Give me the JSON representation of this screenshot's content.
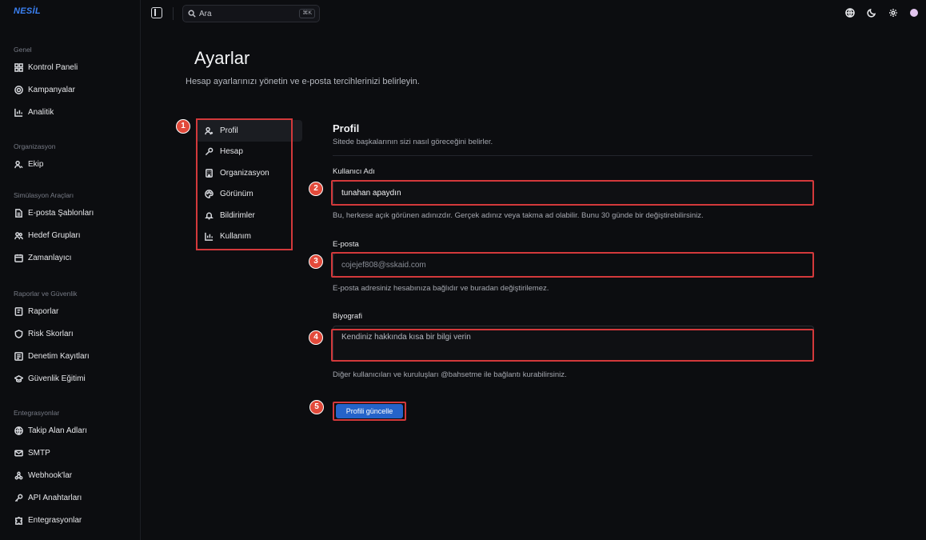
{
  "app": {
    "logo": "NESİL"
  },
  "topbar": {
    "search_placeholder": "Ara",
    "search_shortcut": "⌘K"
  },
  "sidebar": {
    "groups": [
      {
        "title": "Genel",
        "items": [
          {
            "label": "Kontrol Paneli",
            "icon": "grid-icon"
          },
          {
            "label": "Kampanyalar",
            "icon": "target-icon"
          },
          {
            "label": "Analitik",
            "icon": "bar-chart-icon"
          }
        ]
      },
      {
        "title": "Organizasyon",
        "items": [
          {
            "label": "Ekip",
            "icon": "users-icon"
          }
        ]
      },
      {
        "title": "Simülasyon Araçları",
        "items": [
          {
            "label": "E-posta Şablonları",
            "icon": "file-icon"
          },
          {
            "label": "Hedef Grupları",
            "icon": "group-icon"
          },
          {
            "label": "Zamanlayıcı",
            "icon": "calendar-icon"
          }
        ]
      },
      {
        "title": "Raporlar ve Güvenlik",
        "items": [
          {
            "label": "Raporlar",
            "icon": "report-icon"
          },
          {
            "label": "Risk Skorları",
            "icon": "shield-icon"
          },
          {
            "label": "Denetim Kayıtları",
            "icon": "audit-icon"
          },
          {
            "label": "Güvenlik Eğitimi",
            "icon": "graduation-icon"
          }
        ]
      },
      {
        "title": "Entegrasyonlar",
        "items": [
          {
            "label": "Takip Alan Adları",
            "icon": "globe-icon"
          },
          {
            "label": "SMTP",
            "icon": "mail-icon"
          },
          {
            "label": "Webhook'lar",
            "icon": "webhook-icon"
          },
          {
            "label": "API Anahtarları",
            "icon": "key-icon"
          },
          {
            "label": "Entegrasyonlar",
            "icon": "puzzle-icon"
          }
        ]
      }
    ]
  },
  "page": {
    "title": "Ayarlar",
    "subtitle": "Hesap ayarlarınızı yönetin ve e-posta tercihlerinizi belirleyin."
  },
  "settings_nav": [
    {
      "label": "Profil",
      "icon": "user-icon",
      "active": true
    },
    {
      "label": "Hesap",
      "icon": "wrench-icon"
    },
    {
      "label": "Organizasyon",
      "icon": "building-icon"
    },
    {
      "label": "Görünüm",
      "icon": "palette-icon"
    },
    {
      "label": "Bildirimler",
      "icon": "bell-icon"
    },
    {
      "label": "Kullanım",
      "icon": "bar-chart-icon"
    }
  ],
  "profile": {
    "title": "Profil",
    "subtitle": "Sitede başkalarının sizi nasıl göreceğini belirler.",
    "username_label": "Kullanıcı Adı",
    "username_value": "tunahan apaydın",
    "username_hint": "Bu, herkese açık görünen adınızdır. Gerçek adınız veya takma ad olabilir. Bunu 30 günde bir değiştirebilirsiniz.",
    "email_label": "E-posta",
    "email_value": "cojejef808@sskaid.com",
    "email_hint": "E-posta adresiniz hesabınıza bağlıdır ve buradan değiştirilemez.",
    "bio_label": "Biyografi",
    "bio_placeholder": "Kendiniz hakkında kısa bir bilgi verin",
    "bio_hint": "Diğer kullanıcıları ve kuruluşları @bahsetme ile bağlantı kurabilirsiniz.",
    "update_button": "Profili güncelle"
  },
  "annotations": [
    "1",
    "2",
    "3",
    "4",
    "5"
  ],
  "colors": {
    "accent": "#2563c9",
    "highlight": "#d3393b",
    "badge": "#e24a3b",
    "background": "#0c0d10"
  }
}
